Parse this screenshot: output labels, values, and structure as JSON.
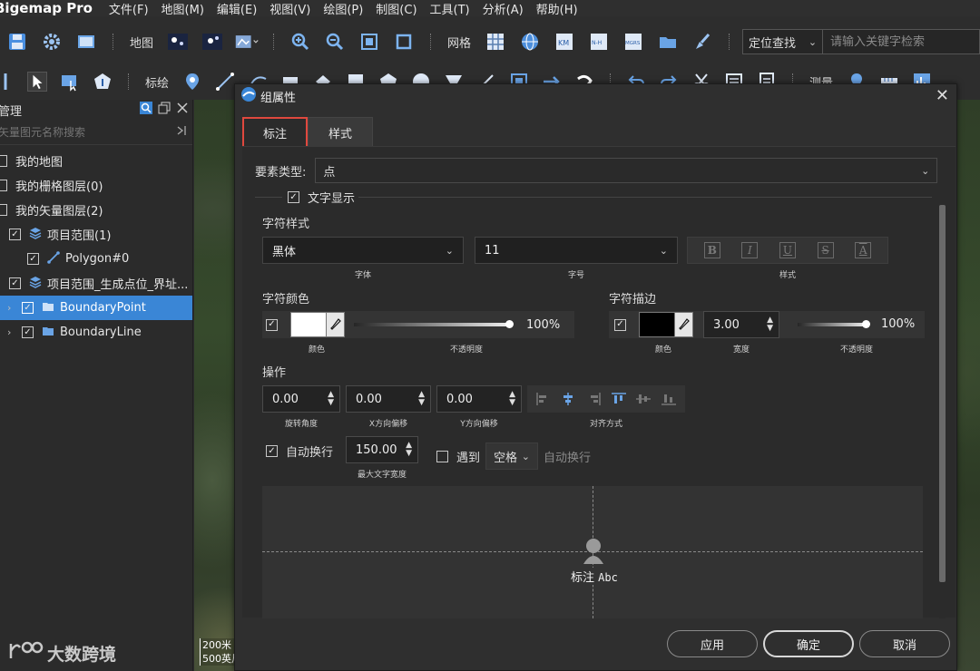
{
  "app": {
    "title": "Bigemap Pro",
    "menu": [
      "文件(F)",
      "地图(M)",
      "编辑(E)",
      "视图(V)",
      "绘图(P)",
      "制图(C)",
      "工具(T)",
      "分析(A)",
      "帮助(H)"
    ]
  },
  "toolbar1": {
    "map_label": "地图",
    "grid_label": "网格",
    "search_mode": "定位查找",
    "search_placeholder": "请输入关键字检索"
  },
  "toolbar2": {
    "plot_label": "标绘",
    "measure_label": "测量"
  },
  "left_panel": {
    "title": "管理",
    "search_placeholder": "矢量图元名称搜索",
    "tree": [
      {
        "label": "我的地图",
        "checked": false
      },
      {
        "label": "我的栅格图层(0)",
        "checked": false
      },
      {
        "label": "我的矢量图层(2)",
        "checked": false
      },
      {
        "label": "项目范围(1)",
        "checked": true
      },
      {
        "label": "Polygon#0",
        "checked": true
      },
      {
        "label": "项目范围_生成点位_界址...",
        "checked": true
      },
      {
        "label": "BoundaryPoint",
        "checked": true
      },
      {
        "label": "BoundaryLine",
        "checked": true
      }
    ]
  },
  "map": {
    "scale_line1": "200米",
    "scale_line2": "500英尺"
  },
  "watermark": "大数跨境",
  "dialog": {
    "title": "组属性",
    "tabs": [
      "标注",
      "样式"
    ],
    "feature_type_label": "要素类型:",
    "feature_type_value": "点",
    "text_display_label": "文字显示",
    "char_style_title": "字符样式",
    "font_value": "黑体",
    "font_caption": "字体",
    "size_value": "11",
    "size_caption": "字号",
    "style_caption": "样式",
    "style_buttons": [
      "B",
      "I",
      "U",
      "S",
      "A"
    ],
    "char_color_title": "字符颜色",
    "color_caption": "颜色",
    "opacity_value": "100%",
    "opacity_caption": "不透明度",
    "outline_title": "字符描边",
    "outline_color_caption": "颜色",
    "outline_width_value": "3.00",
    "outline_width_caption": "宽度",
    "outline_opacity_value": "100%",
    "outline_opacity_caption": "不透明度",
    "operation_title": "操作",
    "rotation_value": "0.00",
    "rotation_caption": "旋转角度",
    "x_offset_value": "0.00",
    "x_offset_caption": "X方向偏移",
    "y_offset_value": "0.00",
    "y_offset_caption": "Y方向偏移",
    "align_caption": "对齐方式",
    "auto_wrap_label": "自动换行",
    "max_width_value": "150.00",
    "max_width_caption": "最大文字宽度",
    "meet_label": "遇到",
    "meet_value": "空格",
    "meet_wrap_label": "自动换行",
    "preview_label": "标注",
    "preview_abc": "Abc",
    "apply_button": "应用",
    "ok_button": "确定",
    "cancel_button": "取消"
  },
  "colors": {
    "accent": "#3a86d6",
    "tab_highlight": "#e0483e",
    "char_color": "#ffffff",
    "outline_color": "#000000"
  }
}
